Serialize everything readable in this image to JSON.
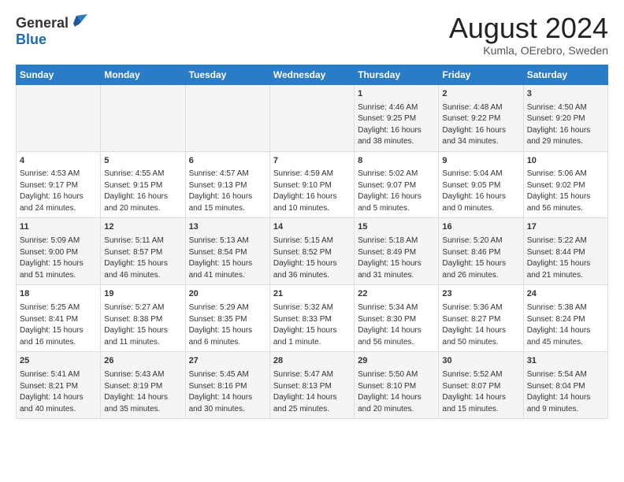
{
  "header": {
    "logo_general": "General",
    "logo_blue": "Blue",
    "month_title": "August 2024",
    "location": "Kumla, OErebro, Sweden"
  },
  "days_of_week": [
    "Sunday",
    "Monday",
    "Tuesday",
    "Wednesday",
    "Thursday",
    "Friday",
    "Saturday"
  ],
  "weeks": [
    [
      {
        "day": "",
        "info": ""
      },
      {
        "day": "",
        "info": ""
      },
      {
        "day": "",
        "info": ""
      },
      {
        "day": "",
        "info": ""
      },
      {
        "day": "1",
        "info": "Sunrise: 4:46 AM\nSunset: 9:25 PM\nDaylight: 16 hours\nand 38 minutes."
      },
      {
        "day": "2",
        "info": "Sunrise: 4:48 AM\nSunset: 9:22 PM\nDaylight: 16 hours\nand 34 minutes."
      },
      {
        "day": "3",
        "info": "Sunrise: 4:50 AM\nSunset: 9:20 PM\nDaylight: 16 hours\nand 29 minutes."
      }
    ],
    [
      {
        "day": "4",
        "info": "Sunrise: 4:53 AM\nSunset: 9:17 PM\nDaylight: 16 hours\nand 24 minutes."
      },
      {
        "day": "5",
        "info": "Sunrise: 4:55 AM\nSunset: 9:15 PM\nDaylight: 16 hours\nand 20 minutes."
      },
      {
        "day": "6",
        "info": "Sunrise: 4:57 AM\nSunset: 9:13 PM\nDaylight: 16 hours\nand 15 minutes."
      },
      {
        "day": "7",
        "info": "Sunrise: 4:59 AM\nSunset: 9:10 PM\nDaylight: 16 hours\nand 10 minutes."
      },
      {
        "day": "8",
        "info": "Sunrise: 5:02 AM\nSunset: 9:07 PM\nDaylight: 16 hours\nand 5 minutes."
      },
      {
        "day": "9",
        "info": "Sunrise: 5:04 AM\nSunset: 9:05 PM\nDaylight: 16 hours\nand 0 minutes."
      },
      {
        "day": "10",
        "info": "Sunrise: 5:06 AM\nSunset: 9:02 PM\nDaylight: 15 hours\nand 56 minutes."
      }
    ],
    [
      {
        "day": "11",
        "info": "Sunrise: 5:09 AM\nSunset: 9:00 PM\nDaylight: 15 hours\nand 51 minutes."
      },
      {
        "day": "12",
        "info": "Sunrise: 5:11 AM\nSunset: 8:57 PM\nDaylight: 15 hours\nand 46 minutes."
      },
      {
        "day": "13",
        "info": "Sunrise: 5:13 AM\nSunset: 8:54 PM\nDaylight: 15 hours\nand 41 minutes."
      },
      {
        "day": "14",
        "info": "Sunrise: 5:15 AM\nSunset: 8:52 PM\nDaylight: 15 hours\nand 36 minutes."
      },
      {
        "day": "15",
        "info": "Sunrise: 5:18 AM\nSunset: 8:49 PM\nDaylight: 15 hours\nand 31 minutes."
      },
      {
        "day": "16",
        "info": "Sunrise: 5:20 AM\nSunset: 8:46 PM\nDaylight: 15 hours\nand 26 minutes."
      },
      {
        "day": "17",
        "info": "Sunrise: 5:22 AM\nSunset: 8:44 PM\nDaylight: 15 hours\nand 21 minutes."
      }
    ],
    [
      {
        "day": "18",
        "info": "Sunrise: 5:25 AM\nSunset: 8:41 PM\nDaylight: 15 hours\nand 16 minutes."
      },
      {
        "day": "19",
        "info": "Sunrise: 5:27 AM\nSunset: 8:38 PM\nDaylight: 15 hours\nand 11 minutes."
      },
      {
        "day": "20",
        "info": "Sunrise: 5:29 AM\nSunset: 8:35 PM\nDaylight: 15 hours\nand 6 minutes."
      },
      {
        "day": "21",
        "info": "Sunrise: 5:32 AM\nSunset: 8:33 PM\nDaylight: 15 hours\nand 1 minute."
      },
      {
        "day": "22",
        "info": "Sunrise: 5:34 AM\nSunset: 8:30 PM\nDaylight: 14 hours\nand 56 minutes."
      },
      {
        "day": "23",
        "info": "Sunrise: 5:36 AM\nSunset: 8:27 PM\nDaylight: 14 hours\nand 50 minutes."
      },
      {
        "day": "24",
        "info": "Sunrise: 5:38 AM\nSunset: 8:24 PM\nDaylight: 14 hours\nand 45 minutes."
      }
    ],
    [
      {
        "day": "25",
        "info": "Sunrise: 5:41 AM\nSunset: 8:21 PM\nDaylight: 14 hours\nand 40 minutes."
      },
      {
        "day": "26",
        "info": "Sunrise: 5:43 AM\nSunset: 8:19 PM\nDaylight: 14 hours\nand 35 minutes."
      },
      {
        "day": "27",
        "info": "Sunrise: 5:45 AM\nSunset: 8:16 PM\nDaylight: 14 hours\nand 30 minutes."
      },
      {
        "day": "28",
        "info": "Sunrise: 5:47 AM\nSunset: 8:13 PM\nDaylight: 14 hours\nand 25 minutes."
      },
      {
        "day": "29",
        "info": "Sunrise: 5:50 AM\nSunset: 8:10 PM\nDaylight: 14 hours\nand 20 minutes."
      },
      {
        "day": "30",
        "info": "Sunrise: 5:52 AM\nSunset: 8:07 PM\nDaylight: 14 hours\nand 15 minutes."
      },
      {
        "day": "31",
        "info": "Sunrise: 5:54 AM\nSunset: 8:04 PM\nDaylight: 14 hours\nand 9 minutes."
      }
    ]
  ]
}
